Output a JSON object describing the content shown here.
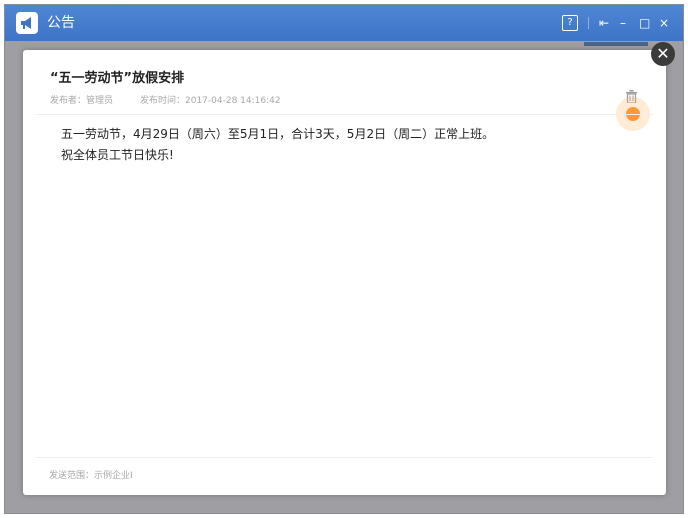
{
  "window": {
    "title": "公告",
    "help_glyph": "?",
    "dock_glyph": "⇤",
    "min_glyph": "–",
    "max_glyph": "□",
    "close_glyph": "×"
  },
  "modal": {
    "close_glyph": "✕",
    "title": "“五一劳动节”放假安排",
    "publisher": "发布者：管理员",
    "publish_time": "发布时间：2017-04-28 14:16:42",
    "body_lines": [
      "五一劳动节，4月29日（周六）至5月1日，合计3天，5月2日（周二）正常上班。",
      "祝全体员工节日快乐!"
    ],
    "footer": "发送范围：示例企业I"
  },
  "colors": {
    "titlebar": "#4a7fce",
    "accent_dot": "#ff9933"
  }
}
